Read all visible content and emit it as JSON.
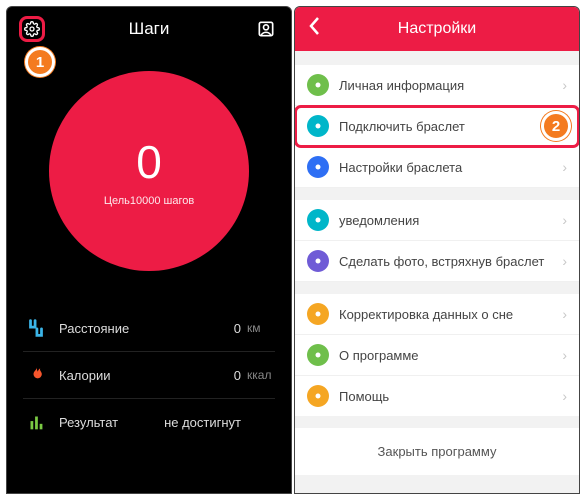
{
  "left": {
    "title": "Шаги",
    "steps_count": "0",
    "goal_text": "Цель10000 шагов",
    "stats": [
      {
        "label": "Расстояние",
        "value": "0",
        "unit": "км"
      },
      {
        "label": "Калории",
        "value": "0",
        "unit": "ккал"
      },
      {
        "label": "Результат",
        "value": "не достигнут",
        "unit": ""
      }
    ]
  },
  "right": {
    "title": "Настройки",
    "items": [
      {
        "label": "Личная информация",
        "color": "#6fbf4b"
      },
      {
        "label": "Подключить браслет",
        "color": "#00b6c9",
        "highlight": true
      },
      {
        "label": "Настройки браслета",
        "color": "#2e6ff4"
      },
      {
        "gap": true
      },
      {
        "label": "уведомления",
        "color": "#00b6c9"
      },
      {
        "label": "Сделать фото, встряхнув браслет",
        "color": "#6f5bd6"
      },
      {
        "gap": true
      },
      {
        "label": "Корректировка данных о сне",
        "color": "#f5a623"
      },
      {
        "label": "О программе",
        "color": "#6fbf4b"
      },
      {
        "label": "Помощь",
        "color": "#f5a623"
      }
    ],
    "close_label": "Закрыть программу"
  },
  "badges": {
    "one": "1",
    "two": "2"
  }
}
